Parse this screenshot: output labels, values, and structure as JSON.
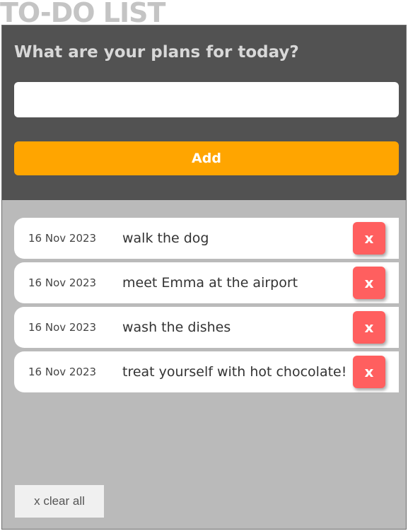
{
  "app": {
    "title": "TO-DO LIST"
  },
  "header": {
    "prompt": "What are your plans for today?",
    "input_value": "",
    "input_placeholder": "",
    "add_label": "Add"
  },
  "tasks": [
    {
      "date": "16 Nov 2023",
      "text": "walk the dog",
      "delete_label": "x"
    },
    {
      "date": "16 Nov 2023",
      "text": "meet Emma at the airport",
      "delete_label": "x"
    },
    {
      "date": "16 Nov 2023",
      "text": "wash the dishes",
      "delete_label": "x"
    },
    {
      "date": "16 Nov 2023",
      "text": "treat yourself with hot chocolate!",
      "delete_label": "x"
    }
  ],
  "footer": {
    "clear_all_label": "x clear all"
  },
  "colors": {
    "title": "#c4c4c4",
    "header_background": "#525252",
    "list_background": "#bababa",
    "add_button": "#ffa500",
    "delete_button": "#ff5f5f",
    "clear_all_button": "#f0f0f0"
  }
}
